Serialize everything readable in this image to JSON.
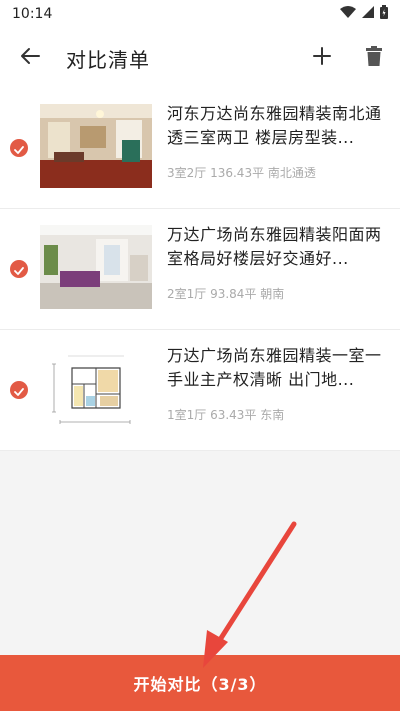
{
  "status_bar": {
    "time": "10:14",
    "icons": [
      "wifi-icon",
      "signal-icon",
      "battery-icon"
    ]
  },
  "toolbar": {
    "title": "对比清单",
    "back_icon": "arrow-left-icon",
    "add_icon": "plus-icon",
    "delete_icon": "trash-icon"
  },
  "items": [
    {
      "title": "河东万达尚东雅园精装南北通透三室两卫 楼层房型装...",
      "meta": "3室2厅 136.43平 南北通透",
      "checked": true,
      "thumb": "living-room-photo"
    },
    {
      "title": "万达广场尚东雅园精装阳面两室格局好楼层好交通好...",
      "meta": "2室1厅 93.84平 朝南",
      "checked": true,
      "thumb": "living-room-photo"
    },
    {
      "title": "万达广场尚东雅园精装一室一手业主产权清晰 出门地...",
      "meta": "1室1厅 63.43平 东南",
      "checked": true,
      "thumb": "floor-plan-image"
    }
  ],
  "bottom_button": {
    "label": "开始对比（3/3）"
  },
  "colors": {
    "accent": "#e8583c",
    "check": "#e25a45",
    "annotation_arrow": "#e8463c"
  }
}
